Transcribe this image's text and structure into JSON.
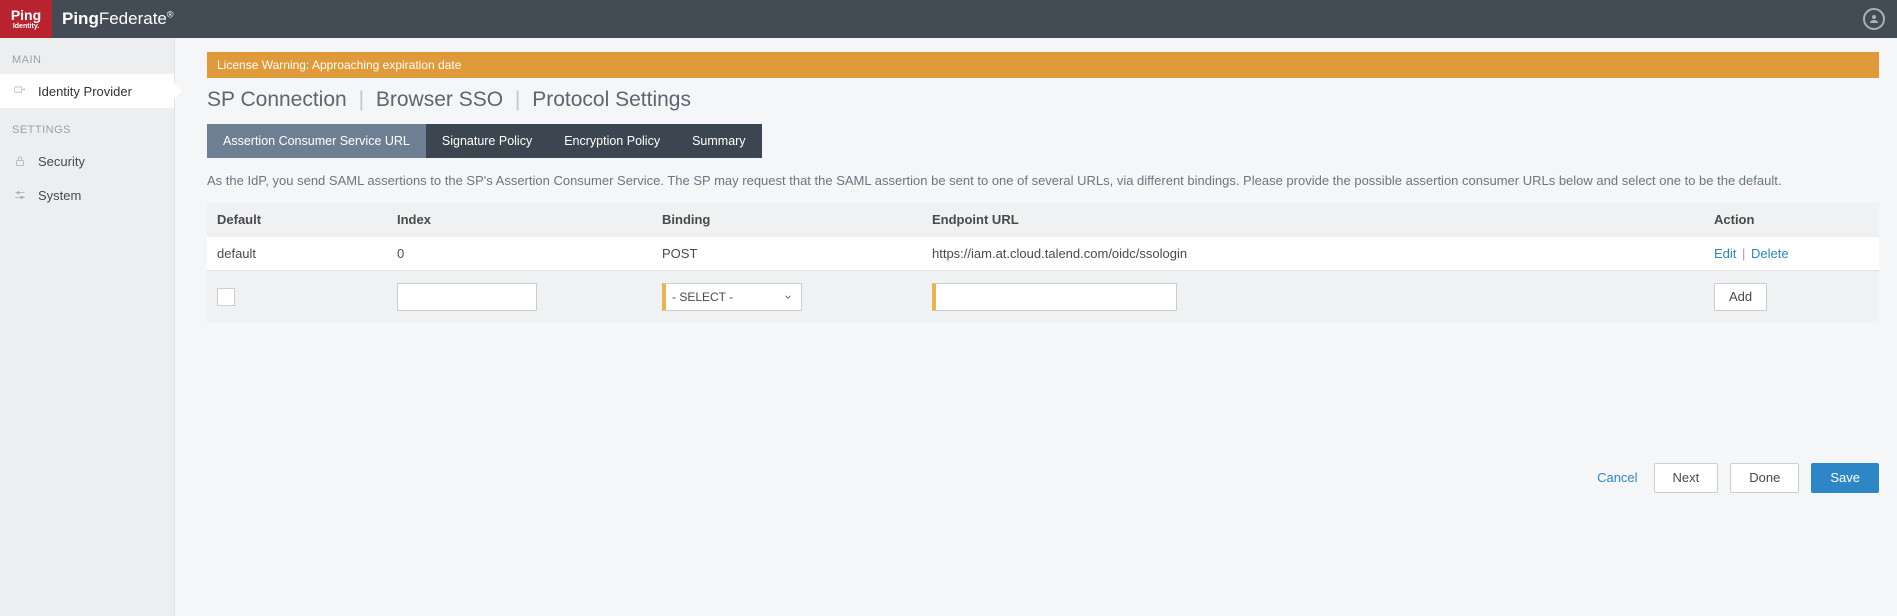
{
  "brand": {
    "logo_top": "Ping",
    "logo_bottom": "Identity.",
    "product_prefix": "Ping",
    "product_suffix": "Federate"
  },
  "sidebar": {
    "sections": {
      "main": {
        "label": "MAIN",
        "items": [
          {
            "label": "Identity Provider"
          }
        ]
      },
      "settings": {
        "label": "SETTINGS",
        "items": [
          {
            "label": "Security"
          },
          {
            "label": "System"
          }
        ]
      }
    }
  },
  "warning": "License Warning: Approaching expiration date",
  "breadcrumb": {
    "sp": "SP Connection",
    "sso": "Browser SSO",
    "proto": "Protocol Settings"
  },
  "tabs": [
    {
      "label": "Assertion Consumer Service URL",
      "active": true
    },
    {
      "label": "Signature Policy",
      "active": false
    },
    {
      "label": "Encryption Policy",
      "active": false
    },
    {
      "label": "Summary",
      "active": false
    }
  ],
  "help_text": "As the IdP, you send SAML assertions to the SP's Assertion Consumer Service. The SP may request that the SAML assertion be sent to one of several URLs, via different bindings. Please provide the possible assertion consumer URLs below and select one to be the default.",
  "table": {
    "headers": {
      "default": "Default",
      "index": "Index",
      "binding": "Binding",
      "url": "Endpoint URL",
      "action": "Action"
    },
    "rows": [
      {
        "default": "default",
        "index": "0",
        "binding": "POST",
        "url": "https://iam.at.cloud.talend.com/oidc/ssologin",
        "actions": {
          "edit": "Edit",
          "delete": "Delete"
        }
      }
    ],
    "new_row": {
      "binding_placeholder": "- SELECT -",
      "add_label": "Add"
    }
  },
  "footer": {
    "cancel": "Cancel",
    "next": "Next",
    "done": "Done",
    "save": "Save"
  }
}
